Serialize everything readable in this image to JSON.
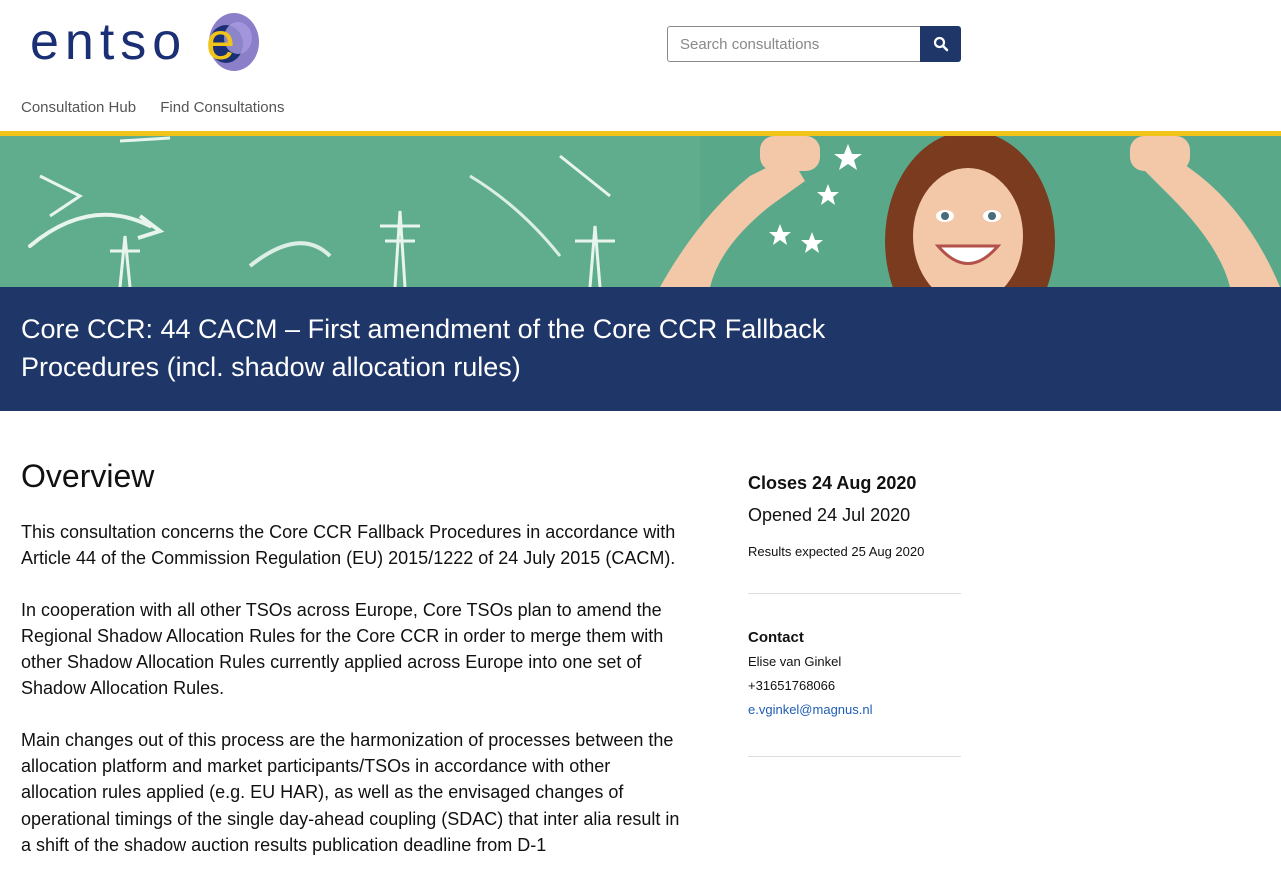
{
  "header": {
    "logo_text": "entso",
    "logo_e": "e",
    "search": {
      "placeholder": "Search consultations",
      "value": ""
    },
    "nav": [
      {
        "label": "Consultation Hub"
      },
      {
        "label": "Find Consultations"
      }
    ]
  },
  "colors": {
    "brand_navy": "#1f3668",
    "accent_yellow": "#f0c419",
    "logo_blue": "#1b2f74",
    "logo_purple": "#8b7fc9",
    "link_blue": "#1f5db5",
    "hero_green": "#5aa88a"
  },
  "hero": {
    "image": "chalkboard-girl-banner"
  },
  "page": {
    "title_line1": "Core CCR: 44 CACM – First amendment of the Core CCR Fallback",
    "title_line2": "Procedures (incl. shadow allocation rules)"
  },
  "overview": {
    "heading": "Overview",
    "paragraphs": [
      "This consultation concerns the Core CCR Fallback Procedures in accordance with Article 44 of the Commission Regulation (EU) 2015/1222 of 24 July 2015 (CACM).",
      "In cooperation with all other TSOs across Europe, Core TSOs plan to amend the Regional Shadow Allocation Rules for the Core CCR in order to merge them with other Shadow Allocation Rules currently applied across Europe into one set of Shadow Allocation Rules.",
      "Main changes out of this process are the harmonization of processes between the allocation platform and market participants/TSOs in accordance with other allocation rules applied (e.g. EU HAR), as well as the envisaged changes of operational timings of the single day-ahead coupling (SDAC) that inter alia result in a shift of the shadow auction results publication deadline from D-1"
    ]
  },
  "sidebar": {
    "closes": "Closes 24 Aug 2020",
    "opened": "Opened 24 Jul 2020",
    "results": "Results expected 25 Aug 2020",
    "contact_heading": "Contact",
    "contact_name": "Elise van Ginkel",
    "contact_phone": "+31651768066",
    "contact_email": "e.vginkel@magnus.nl"
  }
}
